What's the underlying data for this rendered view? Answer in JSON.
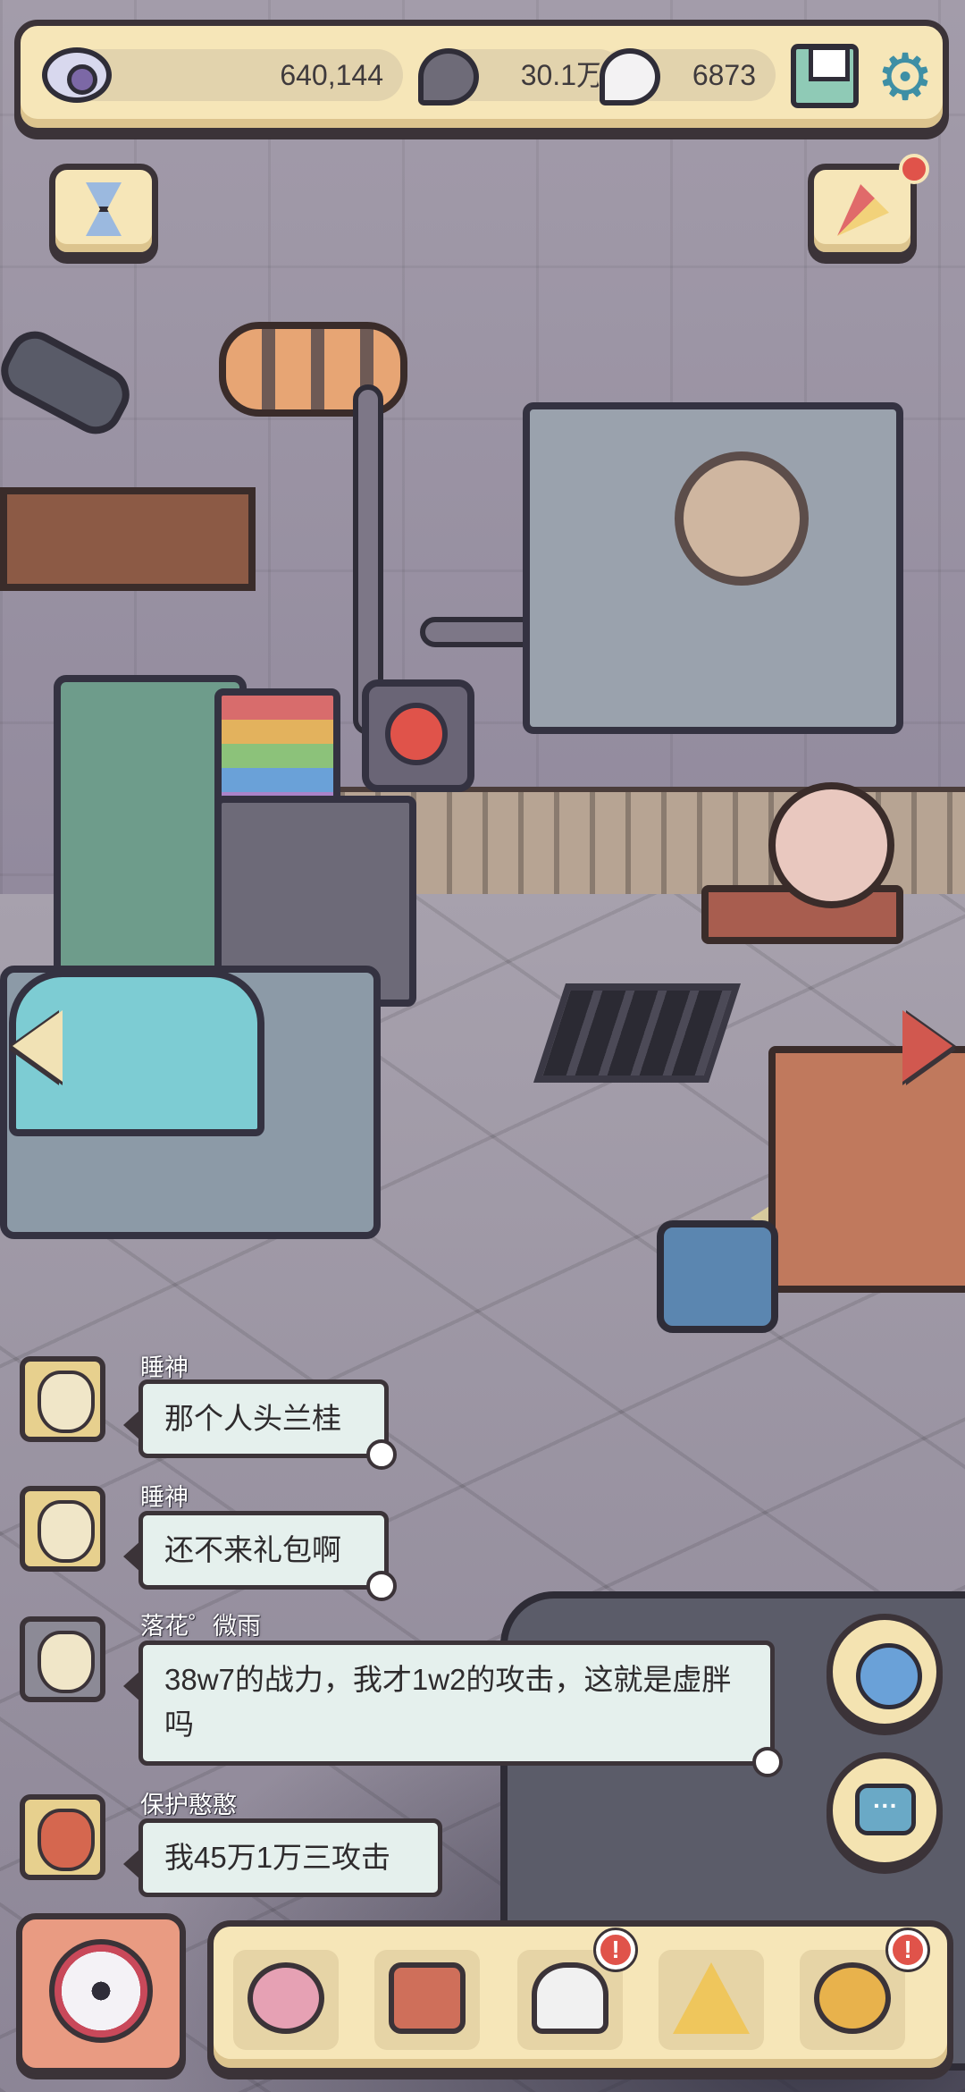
{
  "hud": {
    "eye_stat": "640,144",
    "soul_stat": "30.1万",
    "ghost_stat": "6873"
  },
  "chat": {
    "messages": [
      {
        "user": "睡神",
        "text": "那个人头兰桂"
      },
      {
        "user": "睡神",
        "text": "还不来礼包啊"
      },
      {
        "user": "落花゜微雨",
        "text": "38w7的战力，我才1w2的攻击，这就是虚胖吗"
      },
      {
        "user": "保护憨憨",
        "text": "我45万1万三攻击"
      }
    ]
  },
  "badges": {
    "alert_mark": "!"
  },
  "colors": {
    "panel": "#f6e6b8",
    "outline": "#3b3338",
    "bubble": "#e5f0ed",
    "alert": "#e0534a",
    "gear": "#3e8fa5"
  },
  "icons": {
    "top_left": "eye-icon",
    "soul": "soul-currency-icon",
    "ghost": "ghost-currency-icon",
    "mail": "mail-icon",
    "settings": "gear-icon",
    "timer": "hourglass-icon",
    "event": "party-popper-icon",
    "explore": "planet-icon",
    "chat": "chat-bubble-icon",
    "main": "fan-medallion-icon",
    "nav": [
      "snail-icon",
      "backpack-icon",
      "bust-statue-icon",
      "pyramid-eye-icon",
      "key-icon"
    ]
  }
}
